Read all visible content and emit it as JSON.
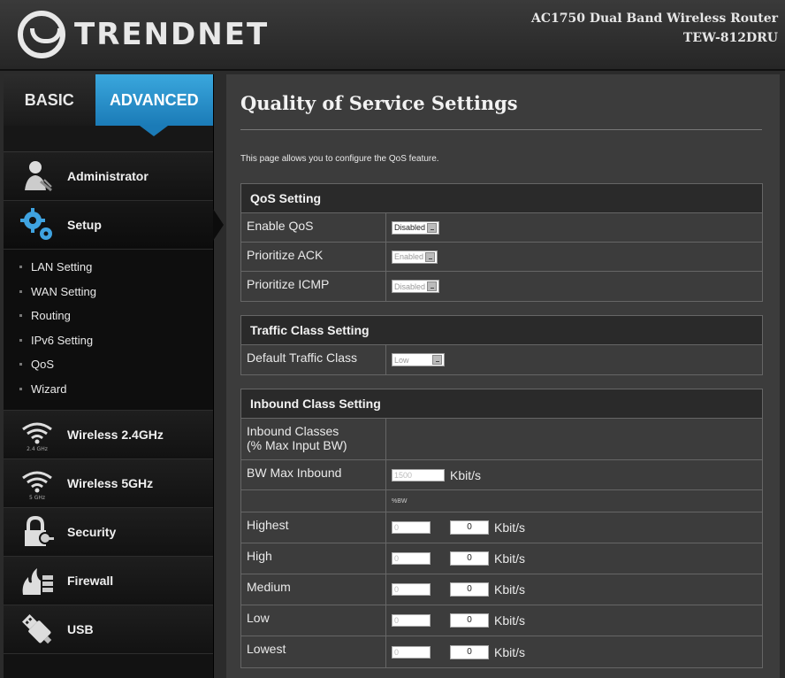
{
  "header": {
    "logo_text": "TRENDNET",
    "product_line1": "AC1750 Dual Band Wireless Router",
    "product_line2": "TEW-812DRU"
  },
  "sidebar": {
    "tabs": {
      "basic": "BASIC",
      "advanced": "ADVANCED"
    },
    "items": [
      {
        "label": "Administrator",
        "icon": "admin-icon"
      },
      {
        "label": "Setup",
        "icon": "gears-icon"
      },
      {
        "label": "Wireless 2.4GHz",
        "icon": "wifi-2g-icon",
        "icon_caption": "2.4 GHz"
      },
      {
        "label": "Wireless 5GHz",
        "icon": "wifi-5g-icon",
        "icon_caption": "5 GHz"
      },
      {
        "label": "Security",
        "icon": "lock-icon"
      },
      {
        "label": "Firewall",
        "icon": "firewall-icon"
      },
      {
        "label": "USB",
        "icon": "usb-icon"
      }
    ],
    "setup_sub": [
      "LAN Setting",
      "WAN Setting",
      "Routing",
      "IPv6 Setting",
      "QoS",
      "Wizard"
    ]
  },
  "main": {
    "title": "Quality of Service Settings",
    "description": "This page allows you to configure the QoS feature.",
    "qos_setting": {
      "header": "QoS Setting",
      "enable_label": "Enable QoS",
      "enable_value": "Disabled",
      "ack_label": "Prioritize ACK",
      "ack_value": "Enabled",
      "icmp_label": "Prioritize ICMP",
      "icmp_value": "Disabled"
    },
    "traffic_class": {
      "header": "Traffic Class Setting",
      "default_label": "Default Traffic Class",
      "default_value": "Low"
    },
    "inbound": {
      "header": "Inbound Class Setting",
      "classes_label_1": "Inbound Classes",
      "classes_label_2": "(% Max Input BW)",
      "bw_label": "BW Max Inbound",
      "bw_value": "1500",
      "bw_unit": "Kbit/s",
      "note": "%BW",
      "rows": [
        {
          "label": "Highest",
          "percent": "0",
          "kbit": "0",
          "unit": "Kbit/s"
        },
        {
          "label": "High",
          "percent": "0",
          "kbit": "0",
          "unit": "Kbit/s"
        },
        {
          "label": "Medium",
          "percent": "0",
          "kbit": "0",
          "unit": "Kbit/s"
        },
        {
          "label": "Low",
          "percent": "0",
          "kbit": "0",
          "unit": "Kbit/s"
        },
        {
          "label": "Lowest",
          "percent": "0",
          "kbit": "0",
          "unit": "Kbit/s"
        }
      ]
    }
  },
  "colors": {
    "accent": "#1f86c4",
    "background": "#3c3c3c",
    "sidebar": "#121212"
  }
}
